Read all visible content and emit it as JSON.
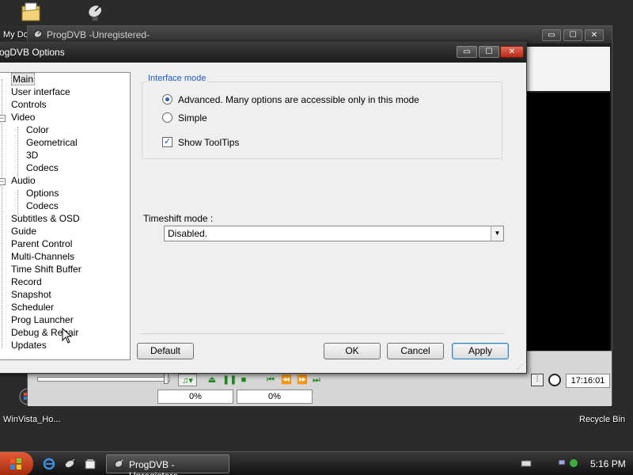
{
  "desktop": {
    "icons": [
      {
        "label": "My Do",
        "icon": "my-documents-icon"
      },
      {
        "label": "",
        "icon": "progdvb-satellite-icon"
      },
      {
        "label": "WinVista_Ho...",
        "icon": "windows-icon"
      },
      {
        "label": "Recycle Bin",
        "icon": "recycle-bin-icon"
      }
    ]
  },
  "main_window": {
    "title": "ProgDVB -Unregistered-",
    "caption": {
      "minimize": "▭",
      "maximize": "☐",
      "close": "✕"
    },
    "player": {
      "audio_icon": "♫▾",
      "eject": "⏏",
      "pause": "❚❚",
      "stop": "■",
      "prev_channel": "⏮",
      "rewind": "⏪",
      "fast_forward": "⏩",
      "next_channel": "⏭",
      "progress_1": "0%",
      "progress_2": "0%",
      "time": "17:16:01"
    }
  },
  "options_dialog": {
    "title": "rogDVB Options",
    "caption": {
      "minimize": "▭",
      "maximize": "☐",
      "close": "✕"
    },
    "tree": [
      {
        "label": "Main",
        "level": 0,
        "selected": true
      },
      {
        "label": "User interface",
        "level": 0
      },
      {
        "label": "Controls",
        "level": 0
      },
      {
        "label": "Video",
        "level": 0,
        "expandable": true
      },
      {
        "label": "Color",
        "level": 1
      },
      {
        "label": "Geometrical",
        "level": 1
      },
      {
        "label": "3D",
        "level": 1
      },
      {
        "label": "Codecs",
        "level": 1
      },
      {
        "label": "Audio",
        "level": 0,
        "expandable": true
      },
      {
        "label": "Options",
        "level": 1
      },
      {
        "label": "Codecs",
        "level": 1
      },
      {
        "label": "Subtitles & OSD",
        "level": 0
      },
      {
        "label": "Guide",
        "level": 0
      },
      {
        "label": "Parent Control",
        "level": 0
      },
      {
        "label": "Multi-Channels",
        "level": 0
      },
      {
        "label": "Time Shift Buffer",
        "level": 0
      },
      {
        "label": "Record",
        "level": 0
      },
      {
        "label": "Snapshot",
        "level": 0
      },
      {
        "label": "Scheduler",
        "level": 0
      },
      {
        "label": "Prog Launcher",
        "level": 0
      },
      {
        "label": "Debug & Repair",
        "level": 0
      },
      {
        "label": "Updates",
        "level": 0
      }
    ],
    "interface_mode": {
      "label": "Interface mode",
      "advanced": "Advanced. Many options are accessible only in this mode",
      "simple": "Simple",
      "selected": "advanced",
      "show_tooltips": "Show ToolTips",
      "show_tooltips_checked": true
    },
    "timeshift": {
      "label": "Timeshift mode :",
      "value": "Disabled."
    },
    "buttons": {
      "default": "Default",
      "ok": "OK",
      "cancel": "Cancel",
      "apply": "Apply"
    }
  },
  "taskbar": {
    "task_label": "ProgDVB -Unregistere...",
    "clock": "5:16 PM"
  },
  "colors": {
    "accent": "#1f5bc2",
    "close_button": "#c2371c",
    "play_controls": "#1a8a1a"
  }
}
